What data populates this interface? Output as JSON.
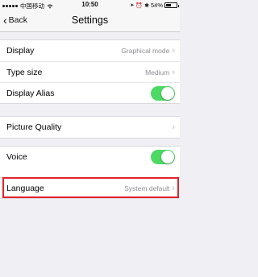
{
  "status_bar": {
    "carrier": "中国移动",
    "time": "10:50",
    "battery_percent": "54%",
    "battery_level": 0.54
  },
  "nav": {
    "back_label": "Back",
    "title": "Settings"
  },
  "settings": {
    "display": {
      "label": "Display",
      "value": "Graphical mode"
    },
    "type_size": {
      "label": "Type size",
      "value": "Medium"
    },
    "display_alias": {
      "label": "Display Alias",
      "enabled": true
    },
    "picture_quality": {
      "label": "Picture Quality"
    },
    "voice": {
      "label": "Voice",
      "enabled": true
    },
    "language": {
      "label": "Language",
      "value": "System default"
    }
  },
  "colors": {
    "toggle_on": "#4cd964",
    "highlight": "#e0242b",
    "background": "#efeff4"
  }
}
